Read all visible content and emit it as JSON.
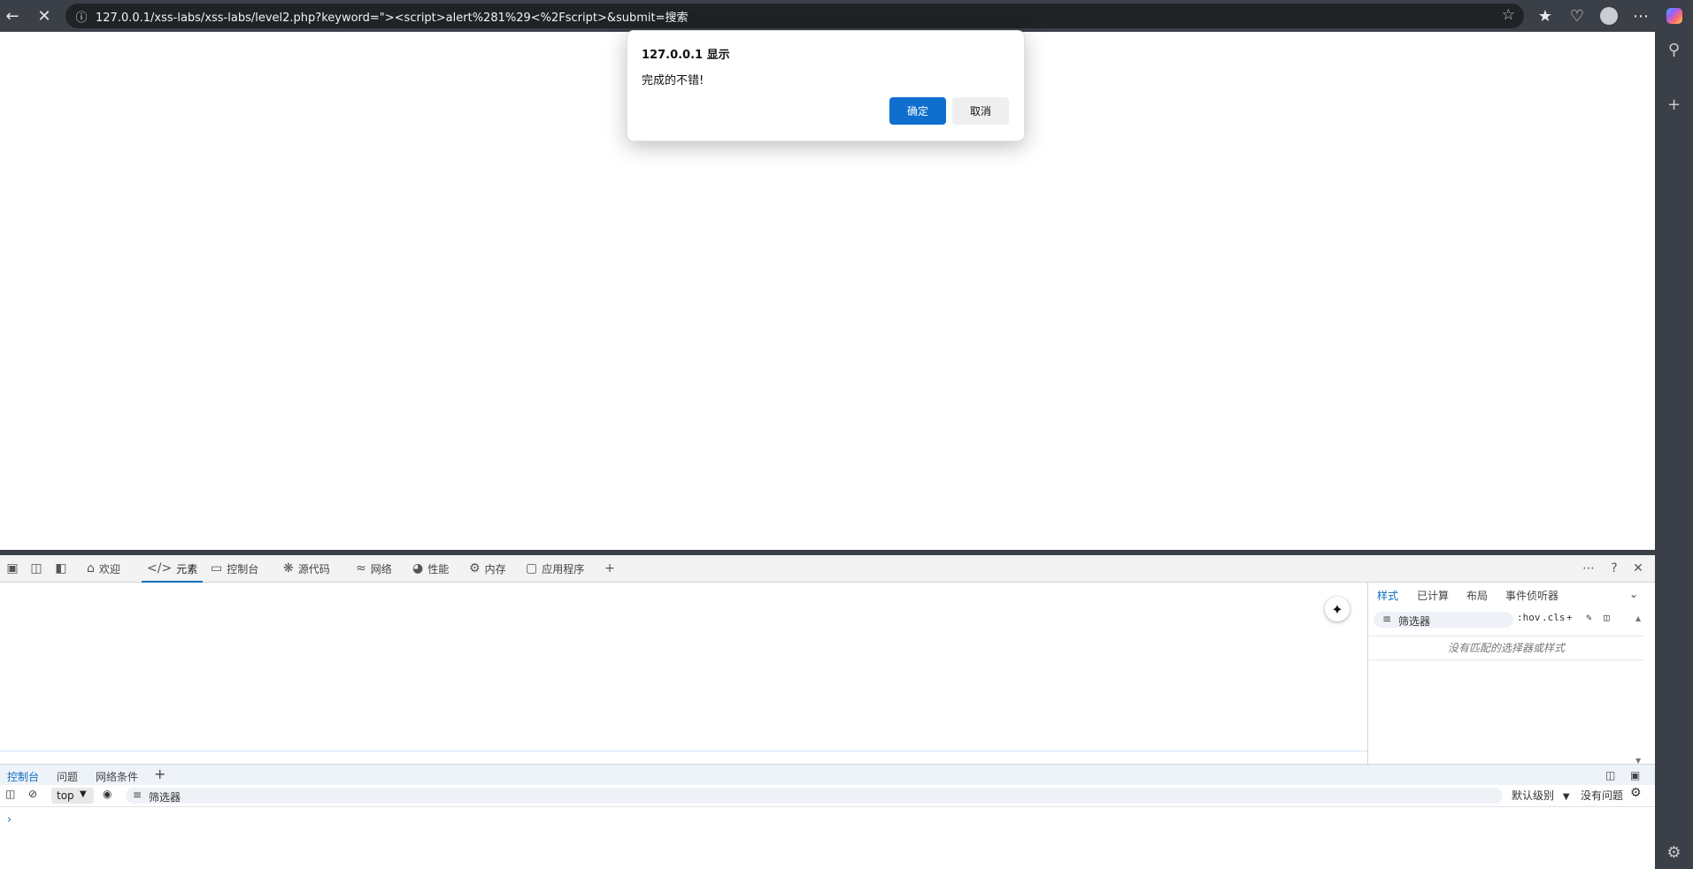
{
  "browser": {
    "url": "127.0.0.1/xss-labs/xss-labs/level2.php?keyword=\"><script>alert%281%29<%2Fscript>&submit=搜索"
  },
  "alert": {
    "title": "127.0.0.1 显示",
    "message": "完成的不错!",
    "ok_label": "确定",
    "cancel_label": "取消"
  },
  "devtools": {
    "tabs": [
      {
        "label": "欢迎",
        "icon": "home-icon"
      },
      {
        "label": "元素",
        "icon": "code-icon"
      },
      {
        "label": "控制台",
        "icon": "terminal-icon"
      },
      {
        "label": "源代码",
        "icon": "bug-icon"
      },
      {
        "label": "网络",
        "icon": "wifi-icon"
      },
      {
        "label": "性能",
        "icon": "gauge-icon"
      },
      {
        "label": "内存",
        "icon": "gear-icon"
      },
      {
        "label": "应用程序",
        "icon": "app-icon"
      }
    ],
    "active_tab": "元素",
    "styles_pane": {
      "tabs": [
        "样式",
        "已计算",
        "布局",
        "事件侦听器"
      ],
      "filter_placeholder": "筛选器",
      "hov_label": ":hov",
      "cls_label": ".cls",
      "empty_message": "没有匹配的选择器或样式"
    },
    "drawer": {
      "tabs": [
        "控制台",
        "问题",
        "网络条件"
      ],
      "context": "top",
      "filter_placeholder": "筛选器",
      "level": "默认级别",
      "issues": "没有问题"
    }
  },
  "colors": {
    "chrome": "#3b3f47",
    "accent": "#0f6cbd",
    "ok_button": "#0e6fcf"
  }
}
